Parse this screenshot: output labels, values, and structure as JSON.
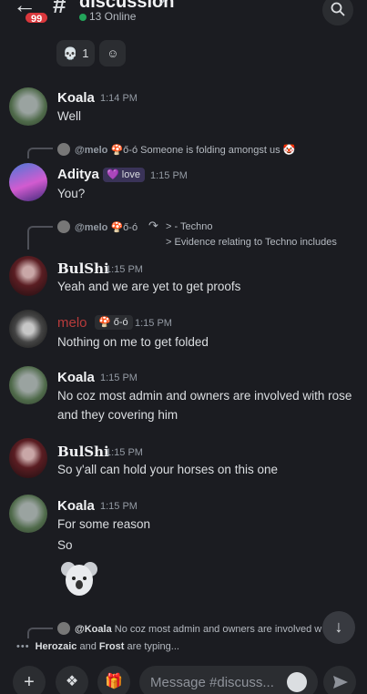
{
  "header": {
    "unread_count": "99",
    "channel_name": "discussion",
    "online_text": "13 Online"
  },
  "reactions": [
    {
      "emoji": "skull",
      "count": "1"
    }
  ],
  "messages": [
    {
      "author": "Koala",
      "time": "1:14 PM",
      "lines": [
        "Well"
      ]
    },
    {
      "reply_to": "@melo",
      "reply_role": "ő-ó",
      "reply_text": "Someone is folding amongst us",
      "author": "Aditya",
      "role": "love",
      "time": "1:15 PM",
      "lines": [
        "You?"
      ]
    },
    {
      "reply_to": "@melo",
      "reply_role": "ő-ó",
      "reply_forward": "> - Techno",
      "reply_forward2": "> Evidence relating to Techno includes",
      "author": "BulShi",
      "time": "1:15 PM",
      "lines": [
        "Yeah and we are yet to get proofs"
      ]
    },
    {
      "author": "melo",
      "role": "ő-ó",
      "time": "1:15 PM",
      "lines": [
        "Nothing on me to get folded"
      ]
    },
    {
      "author": "Koala",
      "time": "1:15 PM",
      "lines": [
        "No coz most admin and owners are involved with rose",
        "and they covering him"
      ]
    },
    {
      "author": "BulShi",
      "time": "1:15 PM",
      "lines": [
        "So y'all can hold your horses on this one"
      ]
    },
    {
      "author": "Koala",
      "time": "1:15 PM",
      "lines": [
        "For some reason",
        "So"
      ]
    }
  ],
  "pending_reply": {
    "to": "@Koala",
    "text": "No coz most admin and owners are involved w"
  },
  "typing": {
    "user1": "Herozaic",
    "and": "and",
    "user2": "Frost",
    "suffix": "are typing..."
  },
  "composer": {
    "placeholder": "Message #discuss..."
  }
}
